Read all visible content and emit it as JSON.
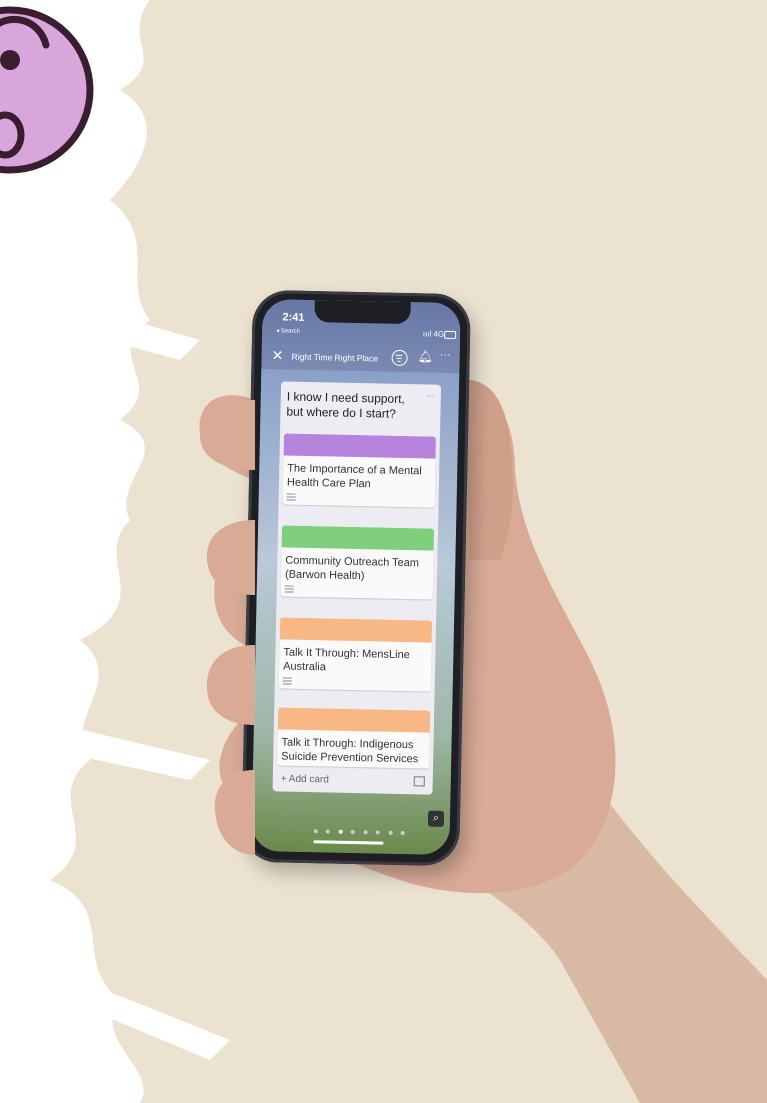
{
  "status_bar": {
    "time": "2:41",
    "back_label": "◂ Search",
    "signal": "ıııl 4G"
  },
  "header": {
    "board_title": "Right Time Right Place"
  },
  "list": {
    "title": "I know I need support, but where do I start?",
    "cards": [
      {
        "label_color": "#b684dc",
        "title": "The Importance of a Mental Health Care Plan"
      },
      {
        "label_color": "#7fcf7c",
        "title": "Community Outreach Team (Barwon Health)"
      },
      {
        "label_color": "#f7b885",
        "title": "Talk It Through: MensLine Australia"
      },
      {
        "label_color": "#f7b885",
        "title": "Talk it Through: Indigenous Suicide Prevention Services"
      }
    ],
    "add_card_label": "+ Add card"
  },
  "icons": [
    "surprised-face-icon",
    "close-icon",
    "filter-icon",
    "bell-icon",
    "more-icon",
    "image-icon",
    "zoom-icon"
  ],
  "colors": {
    "wall": "#ebe2d0",
    "emoji_fill": "#d9a6dc",
    "emoji_outline": "#3a1d2e",
    "board_blue": "#6e7fa6"
  }
}
